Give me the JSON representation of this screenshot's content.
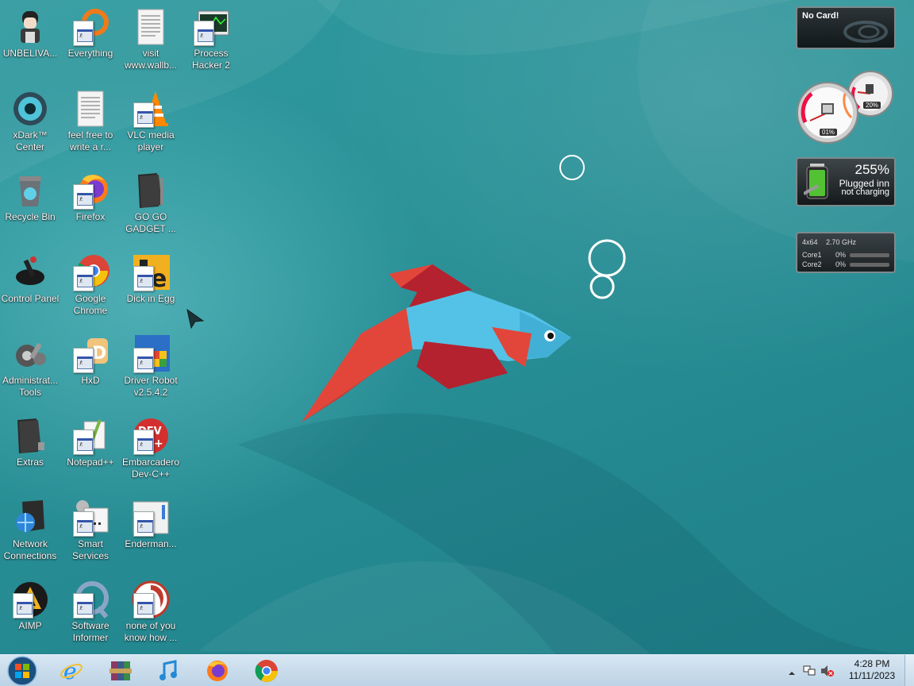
{
  "desktop": {
    "icons": [
      {
        "label": "UNBELIVA...",
        "icon": "anime-character-icon"
      },
      {
        "label": "xDark™\nCenter",
        "icon": "xdark-center-icon"
      },
      {
        "label": "Recycle Bin",
        "icon": "recycle-bin-icon"
      },
      {
        "label": "Control Panel",
        "icon": "control-panel-icon"
      },
      {
        "label": "Administrat...\nTools",
        "icon": "admin-tools-icon"
      },
      {
        "label": "Extras",
        "icon": "folder-icon"
      },
      {
        "label": "Network\nConnections",
        "icon": "network-connections-icon"
      },
      {
        "label": "AIMP",
        "icon": "aimp-icon"
      },
      {
        "label": "Everything",
        "icon": "everything-icon"
      },
      {
        "label": "feel free to\nwrite a r...",
        "icon": "text-document-icon"
      },
      {
        "label": "Firefox",
        "icon": "firefox-icon"
      },
      {
        "label": "Google\nChrome",
        "icon": "chrome-icon"
      },
      {
        "label": "HxD",
        "icon": "hxd-icon"
      },
      {
        "label": "Notepad++",
        "icon": "notepadpp-icon"
      },
      {
        "label": "Smart\nServices",
        "icon": "smart-services-icon"
      },
      {
        "label": "Software\nInformer",
        "icon": "software-informer-icon"
      },
      {
        "label": "visit\nwww.wallb...",
        "icon": "text-document-icon"
      },
      {
        "label": "VLC media\nplayer",
        "icon": "vlc-icon"
      },
      {
        "label": "GO GO\nGADGET ...",
        "icon": "folder-icon"
      },
      {
        "label": "Dick in Egg",
        "icon": "dick-in-egg-icon"
      },
      {
        "label": "Driver Robot\nv2.5.4.2",
        "icon": "driver-robot-icon"
      },
      {
        "label": "Embarcadero\nDev-C++",
        "icon": "devcpp-icon"
      },
      {
        "label": "Enderman...",
        "icon": "enderman-icon"
      },
      {
        "label": "none of you\nknow how ...",
        "icon": "shortcut-icon"
      },
      {
        "label": "Process\nHacker 2",
        "icon": "process-hacker-icon"
      }
    ]
  },
  "gadgets": {
    "gpu": {
      "status": "No Card!"
    },
    "meters": {
      "cpu_label": "01%",
      "mem_label": "20%"
    },
    "battery": {
      "percent": "255%",
      "line1": "Plugged inn",
      "line2": "not charging"
    },
    "cpu": {
      "arch": "4x64",
      "freq": "2.70 GHz",
      "cores": [
        {
          "name": "Core1",
          "usage": "0%"
        },
        {
          "name": "Core2",
          "usage": "0%"
        }
      ]
    }
  },
  "taskbar": {
    "pinned": [
      "internet-explorer-icon",
      "winrar-icon",
      "itunes-icon",
      "firefox-icon",
      "chrome-icon"
    ],
    "clock": {
      "time": "4:28 PM",
      "date": "11/11/2023"
    }
  },
  "colors": {
    "accent": "#2a8f95",
    "fish_body": "#54c2e6",
    "fish_fin_red": "#e2463a",
    "fish_fin_dark": "#b4222f"
  }
}
